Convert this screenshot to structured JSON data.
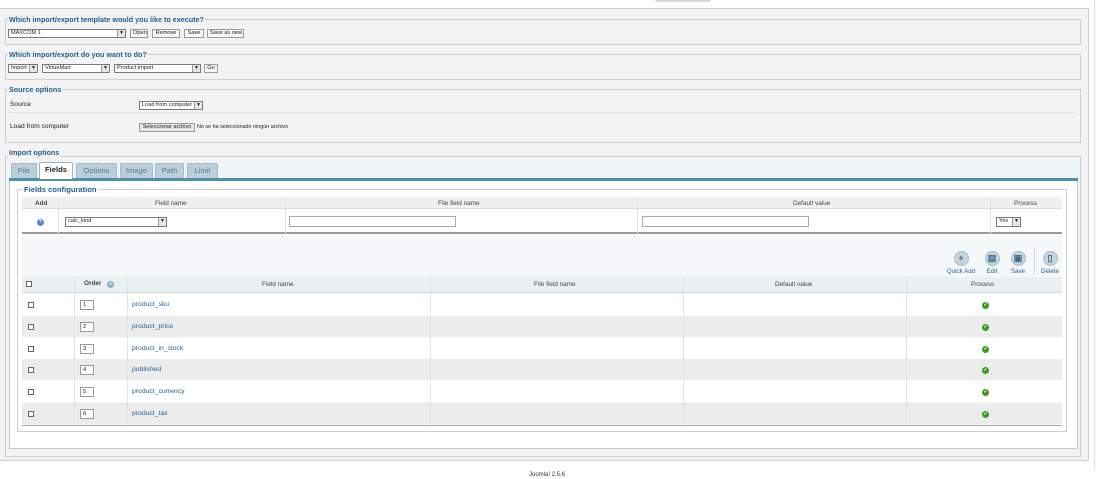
{
  "template_section": {
    "legend": "Which import/export template would you like to execute?",
    "selected_template": "MAXCOM 1",
    "buttons": [
      "Open",
      "Remove",
      "Save",
      "Save as new"
    ]
  },
  "action_section": {
    "legend": "Which import/export do you want to do?",
    "action": "Import",
    "component": "VirtueMart",
    "operation": "Product import",
    "go_label": "Go"
  },
  "source_section": {
    "legend": "Source options",
    "source_label": "Source",
    "source_value": "Load from computer",
    "file_label": "Load from computer",
    "file_button": "Seleccionar archivo",
    "file_status": "No se ha seleccionado ningún archivo"
  },
  "import_options": {
    "legend": "Import options",
    "tabs": [
      "File",
      "Fields",
      "Options",
      "Image",
      "Path",
      "Limit"
    ],
    "active_tab": "Fields"
  },
  "fields_config": {
    "legend": "Fields configuration",
    "add_headers": [
      "Add",
      "Field name",
      "File field name",
      "Default value",
      "Process"
    ],
    "add_row": {
      "field_select": "calc_kind",
      "file_field": "",
      "default_value": "",
      "process": "Yes"
    }
  },
  "toolbar": [
    {
      "label": "Quick Add",
      "icon": "plus-icon"
    },
    {
      "label": "Edit",
      "icon": "edit-icon"
    },
    {
      "label": "Save",
      "icon": "save-icon"
    },
    {
      "label": "Delete",
      "icon": "delete-icon"
    }
  ],
  "table": {
    "headers": {
      "order": "Order",
      "field_name": "Field name",
      "file_field_name": "File field name",
      "default_value": "Default value",
      "process": "Process"
    },
    "rows": [
      {
        "order": "1",
        "field": "product_sku"
      },
      {
        "order": "2",
        "field": "product_price"
      },
      {
        "order": "3",
        "field": "product_in_stock"
      },
      {
        "order": "4",
        "field": "published"
      },
      {
        "order": "5",
        "field": "product_currency"
      },
      {
        "order": "6",
        "field": "product_tax"
      }
    ]
  },
  "footer": "Joomla! 2.5.6",
  "colors": {
    "legend": "#1f5f96",
    "tab_bar": "#4f8fae",
    "process_ok": "#3a9a1e"
  }
}
